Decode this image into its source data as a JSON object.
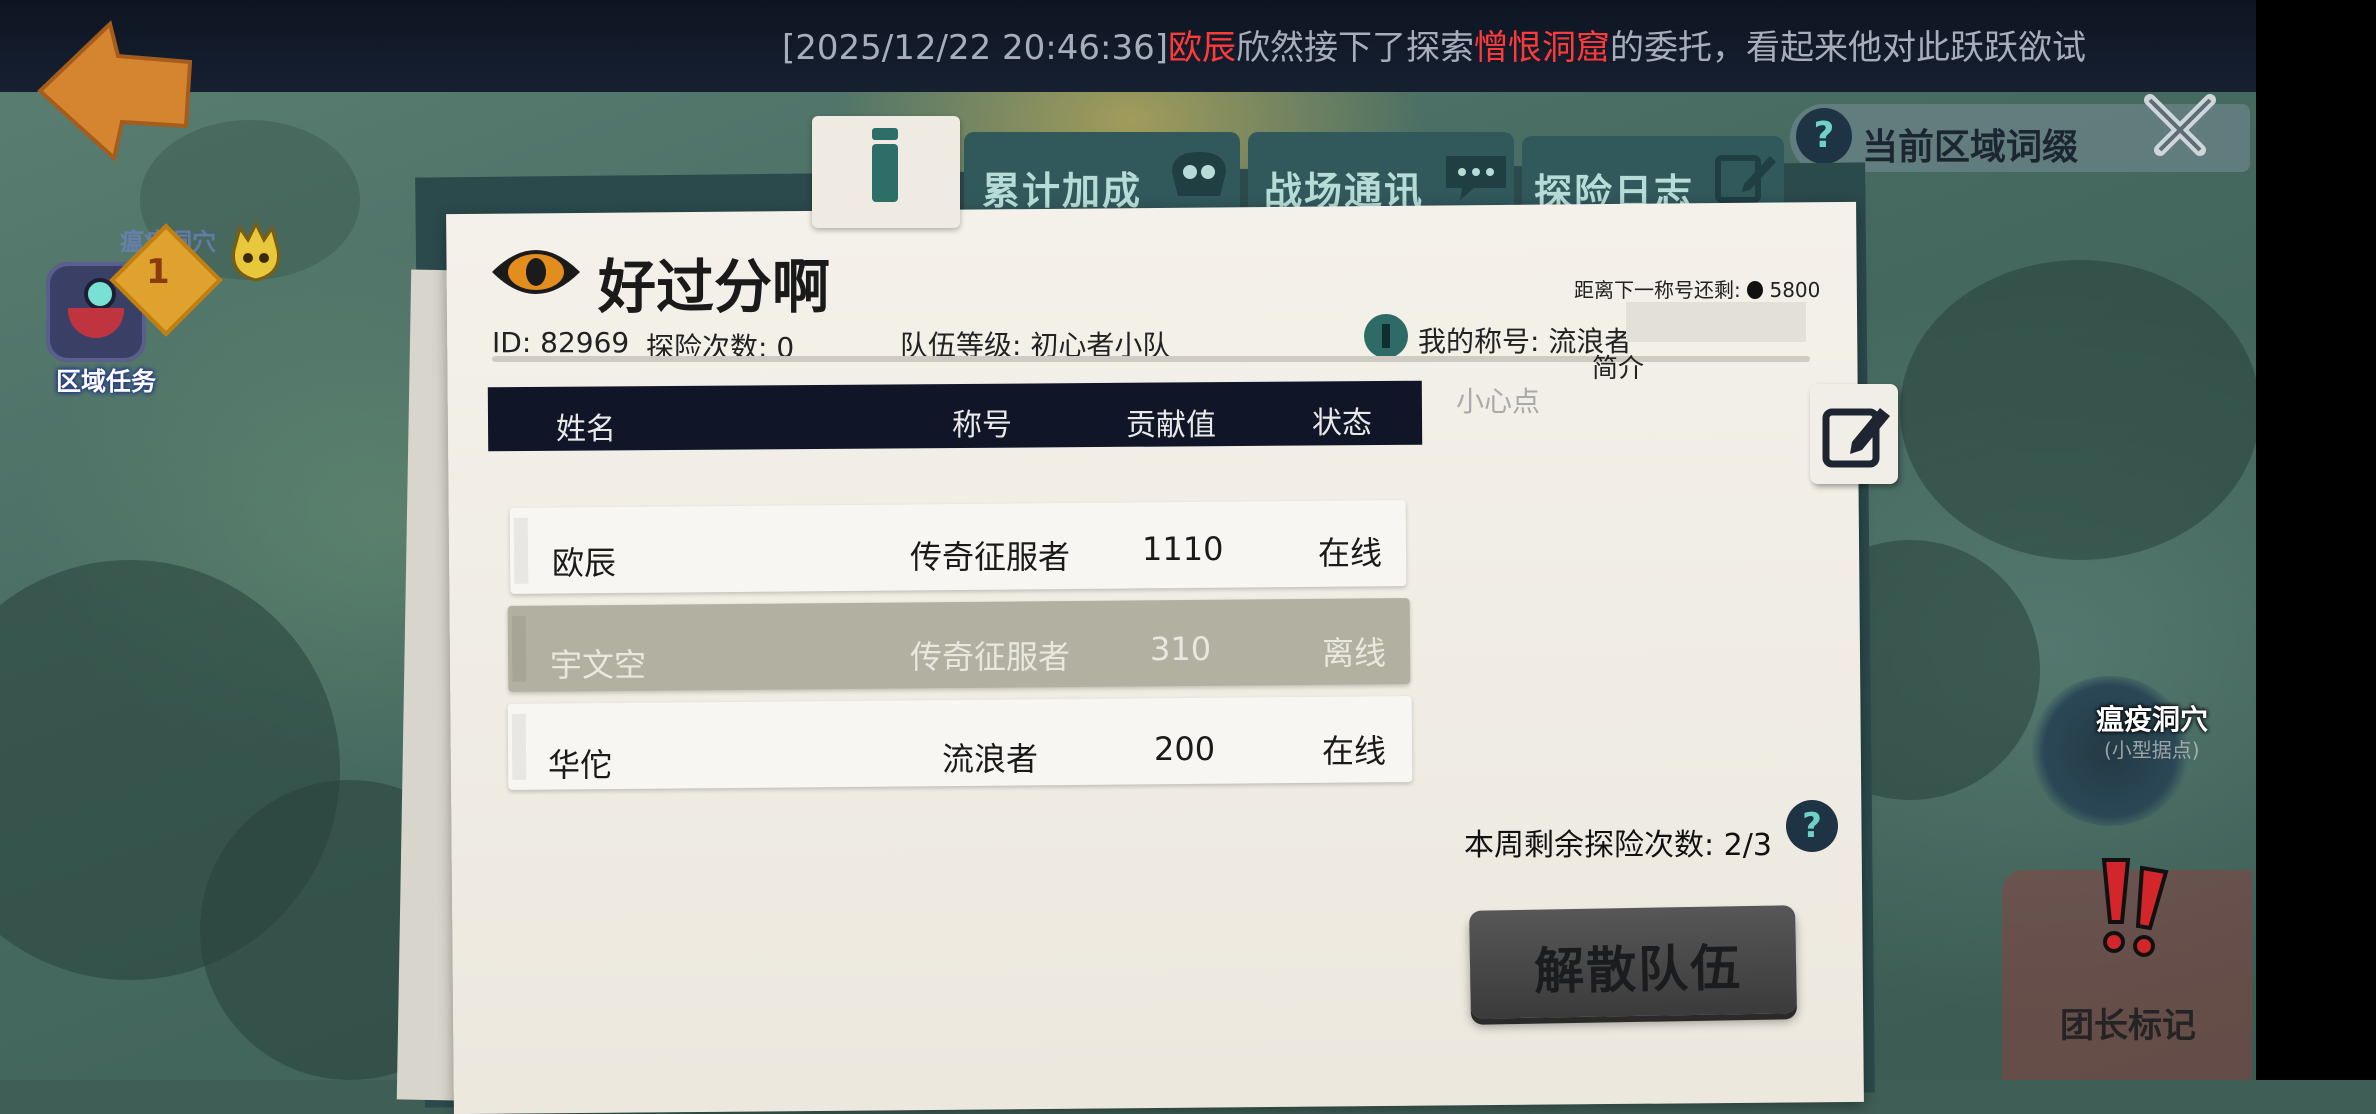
{
  "notice": {
    "timestamp": "[2025/12/22 20:46:36]",
    "player": "欧辰",
    "text_before_place": "欣然接下了探索",
    "place": "憎恨洞窟",
    "text_after_place": "的委托，看起来他对此跃跃欲试"
  },
  "left_panel": {
    "faded_title": "瘟疫洞穴",
    "quest_count": "1",
    "region_quest_label": "区域任务"
  },
  "right_panel": {
    "area_affix_label": "当前区域词缀",
    "help_glyph": "?",
    "plague_cave_label": "瘟疫洞穴",
    "plague_cave_sub": "(小型据点)",
    "leader_mark_label": "团长标记"
  },
  "tabs": {
    "info_icon": "info-icon",
    "cumulative_bonus": "累计加成",
    "battlefield_comms": "战场通讯",
    "exploration_log": "探险日志"
  },
  "team": {
    "name": "好过分啊",
    "id_label": "ID: 82969",
    "exploration_count_label": "探险次数: 0",
    "team_level_label": "队伍等级: 初心者小队",
    "next_title_label": "距离下一称号还剩:",
    "next_title_value": "5800",
    "my_title_label": "我的称号: 流浪者",
    "intro_label": "简介",
    "intro_text": "小心点"
  },
  "table": {
    "headers": [
      "姓名",
      "称号",
      "贡献值",
      "状态"
    ],
    "rows": [
      {
        "name": "欧辰",
        "title": "传奇征服者",
        "contribution": "1110",
        "status": "在线"
      },
      {
        "name": "宇文空",
        "title": "传奇征服者",
        "contribution": "310",
        "status": "离线"
      },
      {
        "name": "华佗",
        "title": "流浪者",
        "contribution": "200",
        "status": "在线"
      }
    ]
  },
  "footer": {
    "weekly_remaining_label": "本周剩余探险次数:",
    "weekly_remaining_value": "2/3",
    "disband_button": "解散队伍"
  },
  "colors": {
    "notice_red": "#ff3a3a",
    "tab_bg": "#31585b",
    "table_header": "#101628",
    "offline_row": "#b2b0a0",
    "disband_btn": "#4a4a4a"
  }
}
